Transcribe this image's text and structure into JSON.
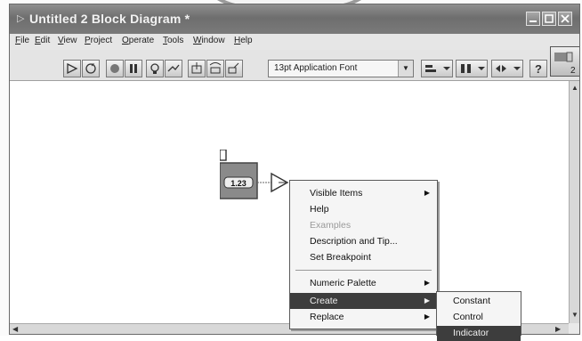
{
  "window": {
    "title": "Untitled 2 Block Diagram *"
  },
  "menubar": {
    "items": [
      "File",
      "Edit",
      "View",
      "Project",
      "Operate",
      "Tools",
      "Window",
      "Help"
    ]
  },
  "toolbar": {
    "font_selector": "13pt Application Font"
  },
  "diagram": {
    "numeric_node_label": "1.23"
  },
  "context_menu": {
    "items": [
      {
        "label": "Visible Items",
        "submenu": true,
        "enabled": true
      },
      {
        "label": "Help",
        "submenu": false,
        "enabled": true
      },
      {
        "label": "Examples",
        "submenu": false,
        "enabled": false
      },
      {
        "label": "Description and Tip...",
        "submenu": false,
        "enabled": true
      },
      {
        "label": "Set Breakpoint",
        "submenu": false,
        "enabled": true
      },
      {
        "label": "Numeric Palette",
        "submenu": true,
        "enabled": true
      },
      {
        "label": "Create",
        "submenu": true,
        "enabled": true,
        "highlighted": true
      },
      {
        "label": "Replace",
        "submenu": true,
        "enabled": true
      }
    ]
  },
  "create_submenu": {
    "items": [
      {
        "label": "Constant"
      },
      {
        "label": "Control"
      },
      {
        "label": "Indicator",
        "highlighted": true
      }
    ]
  },
  "colors": {
    "title_bar": "#7a7a7a",
    "highlight": "#3d3d3d",
    "menu_bg": "#f5f5f5",
    "numeric_node": "#8a8a8a"
  }
}
